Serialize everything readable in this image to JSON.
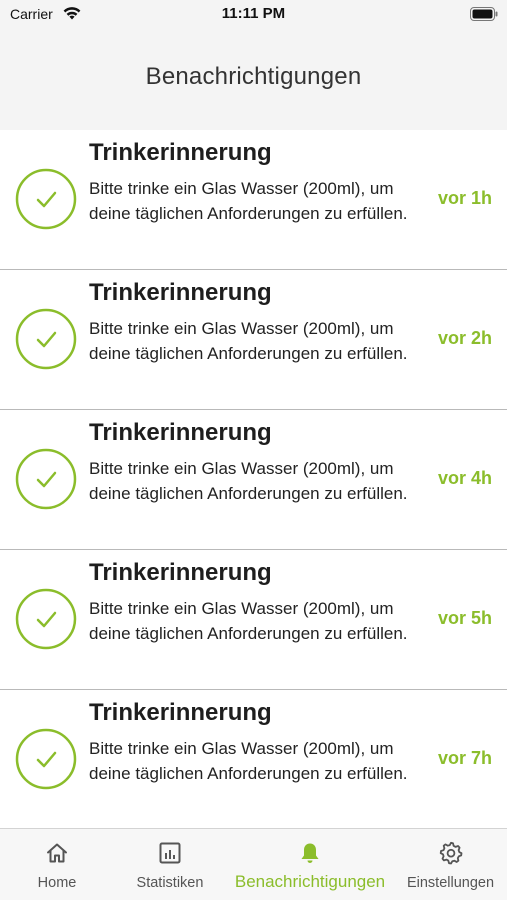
{
  "status_bar": {
    "carrier": "Carrier",
    "time": "11:11 PM"
  },
  "header": {
    "title": "Benachrichtigungen"
  },
  "notifications": [
    {
      "title": "Trinkerinnerung",
      "body": "Bitte trinke ein Glas Wasser (200ml), um deine täglichen Anforderungen zu erfüllen.",
      "time": "vor 1h",
      "icon": "check-circle-icon"
    },
    {
      "title": "Trinkerinnerung",
      "body": "Bitte trinke ein Glas Wasser (200ml), um deine täglichen Anforderungen zu erfüllen.",
      "time": "vor 2h",
      "icon": "check-circle-icon"
    },
    {
      "title": "Trinkerinnerung",
      "body": "Bitte trinke ein Glas Wasser (200ml), um deine täglichen Anforderungen zu erfüllen.",
      "time": "vor 4h",
      "icon": "check-circle-icon"
    },
    {
      "title": "Trinkerinnerung",
      "body": "Bitte trinke ein Glas Wasser (200ml), um deine täglichen Anforderungen zu erfüllen.",
      "time": "vor 5h",
      "icon": "check-circle-icon"
    },
    {
      "title": "Trinkerinnerung",
      "body": "Bitte trinke ein Glas Wasser (200ml), um deine täglichen Anforderungen zu erfüllen.",
      "time": "vor 7h",
      "icon": "check-circle-icon"
    }
  ],
  "tabbar": {
    "items": [
      {
        "label": "Home",
        "icon": "home-icon",
        "active": false
      },
      {
        "label": "Statistiken",
        "icon": "chart-icon",
        "active": false
      },
      {
        "label": "Benachrichtigungen",
        "icon": "bell-icon",
        "active": true
      },
      {
        "label": "Einstellungen",
        "icon": "gear-icon",
        "active": false
      }
    ]
  },
  "colors": {
    "accent": "#8bbd2b",
    "header_bg": "#f4f4f4",
    "divider": "#b9b9b9"
  }
}
